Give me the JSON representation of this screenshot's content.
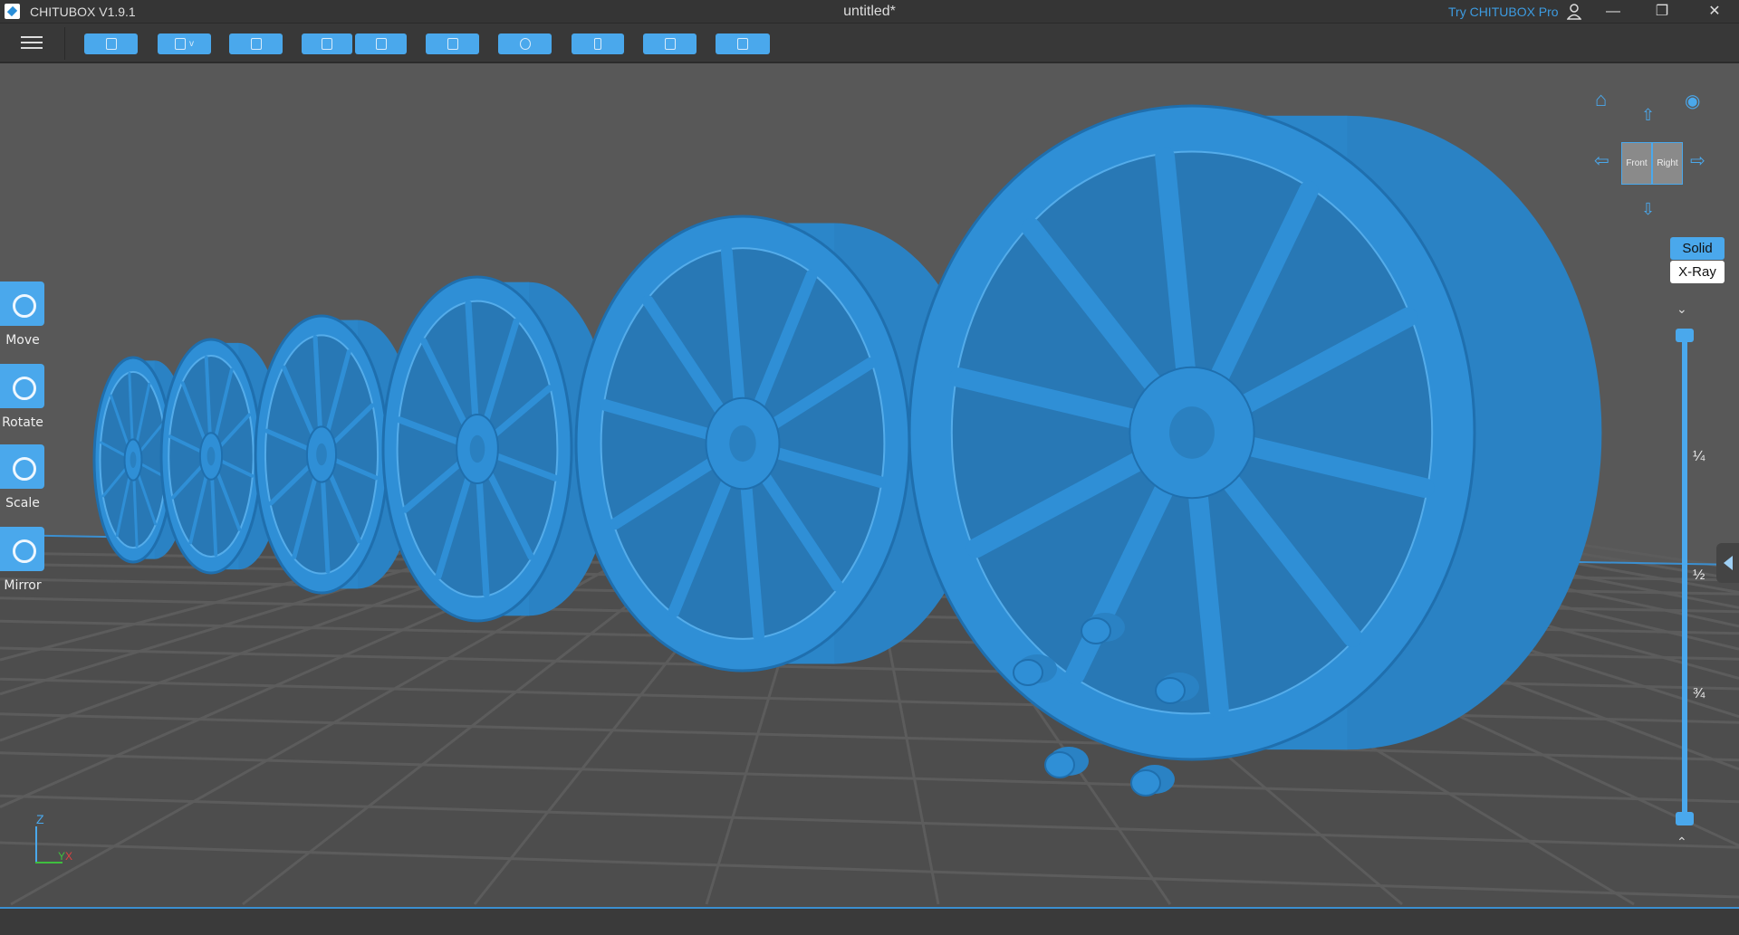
{
  "titlebar": {
    "app_name": "CHITUBOX V1.9.1",
    "document": "untitled*",
    "try_pro": "Try CHITUBOX Pro",
    "minimize": "—",
    "maximize": "❐",
    "close": "✕"
  },
  "toolbar": {
    "buttons": [
      "open-file",
      "save",
      "auto-layout",
      "undo",
      "redo",
      "slice-settings",
      "duplicate",
      "support",
      "hollow",
      "dig-hole"
    ]
  },
  "tools": [
    {
      "label": "Move"
    },
    {
      "label": "Rotate"
    },
    {
      "label": "Scale"
    },
    {
      "label": "Mirror"
    }
  ],
  "view": {
    "cube_front": "Front",
    "cube_right": "Right",
    "solid": "Solid",
    "xray": "X-Ray",
    "active_mode": "Solid"
  },
  "layer_slider": {
    "ticks": [
      "¼",
      "½",
      "¾"
    ],
    "top_value": 1.0,
    "bottom_value": 0.0
  },
  "axes": {
    "z": "Z",
    "y": "Y",
    "x": "X"
  },
  "colors": {
    "accent": "#4aa8ec",
    "model": "#2f8fd6",
    "background": "#575757"
  }
}
